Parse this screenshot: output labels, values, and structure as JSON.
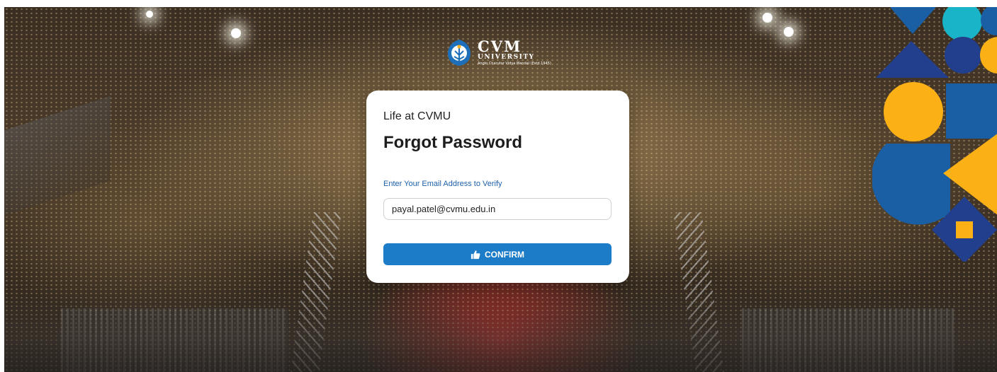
{
  "logo": {
    "name": "CVM",
    "subtitle": "UNIVERSITY",
    "tagline": "Anglo Charutar Vidya Mandal (Estd.1945)",
    "icon": "university-emblem-icon"
  },
  "card": {
    "subtitle": "Life at CVMU",
    "title": "Forgot Password",
    "email_label": "Enter Your Email Address to Verify",
    "email_value": "payal.patel@cvmu.edu.in",
    "email_placeholder": "",
    "confirm_label": "CONFIRM",
    "confirm_icon": "thumbs-up-icon"
  },
  "colors": {
    "primary": "#1c7cc7",
    "label_blue": "#1e5fa8",
    "shape_blue": "#1a5fa3",
    "shape_dark_blue": "#213f8c",
    "shape_yellow": "#fbb116",
    "shape_teal": "#1ab4c8"
  }
}
